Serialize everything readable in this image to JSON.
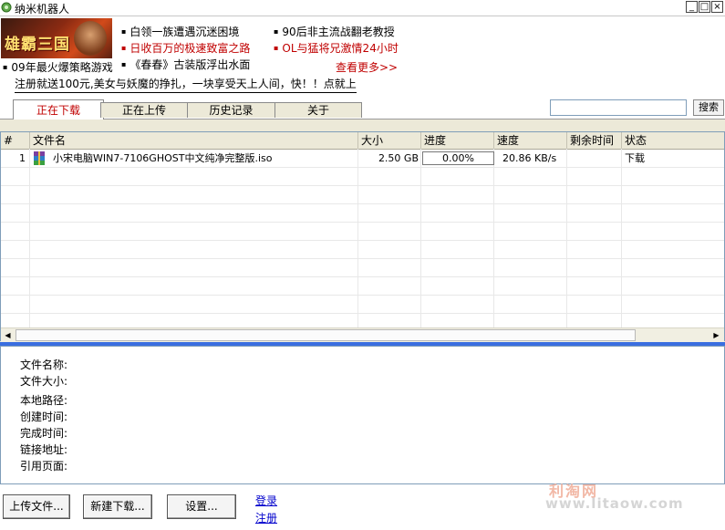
{
  "window": {
    "title": "纳米机器人",
    "minimize": "_",
    "maximize": "□",
    "close": "×"
  },
  "banner": {
    "ad_image_text": "雄霸三国",
    "image_caption": "09年最火爆策略游戏",
    "ads_left": [
      "白领一族遭遇沉迷困境",
      "日收百万的极速致富之路",
      "《春春》古装版浮出水面"
    ],
    "ads_right": [
      "90后非主流战翻老教授",
      "OL与猛将兄激情24小时"
    ],
    "more": "查看更多>>",
    "promo": "注册就送100元,美女与妖魔的挣扎，一块享受天上人间，快！！点就上"
  },
  "tabs": [
    {
      "label": "正在下载",
      "active": true
    },
    {
      "label": "正在上传",
      "active": false
    },
    {
      "label": "历史记录",
      "active": false
    },
    {
      "label": "关于",
      "active": false
    }
  ],
  "search": {
    "value": "",
    "button": "搜索"
  },
  "table": {
    "columns": [
      "#",
      "文件名",
      "大小",
      "进度",
      "速度",
      "剩余时间",
      "状态"
    ],
    "rows": [
      {
        "index": "1",
        "name": "小宋电脑WIN7-7106GHOST中文纯净完整版.iso",
        "size": "2.50 GB",
        "progress_text": "0.00%",
        "progress": 0.0,
        "speed": "20.86 KB/s",
        "remaining": "",
        "status": "下载"
      }
    ]
  },
  "details": {
    "labels": [
      "文件名称:",
      "文件大小:",
      "本地路径:",
      "创建时间:",
      "完成时间:",
      "链接地址:",
      "引用页面:"
    ]
  },
  "buttons": {
    "upload": "上传文件...",
    "new_download": "新建下载...",
    "settings": "设置..."
  },
  "links": {
    "login": "登录",
    "register": "注册"
  },
  "watermark": {
    "line1": "利淘网",
    "line2": "www.litaow.com"
  },
  "colors": {
    "accent": "#3a6ee0",
    "ad_red": "#c00000",
    "link": "#0000cc"
  }
}
